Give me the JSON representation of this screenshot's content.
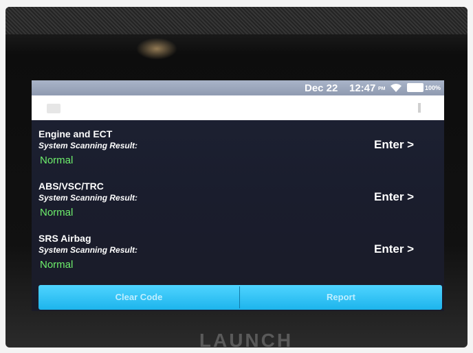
{
  "status_bar": {
    "date": "Dec 22",
    "time": "12:47",
    "ampm": "PM",
    "battery": "100%"
  },
  "systems": [
    {
      "name": "Engine and ECT",
      "scan_label": "System Scanning Result:",
      "result": "Normal",
      "enter_label": "Enter >"
    },
    {
      "name": "ABS/VSC/TRC",
      "scan_label": "System Scanning Result:",
      "result": "Normal",
      "enter_label": "Enter >"
    },
    {
      "name": "SRS Airbag",
      "scan_label": "System Scanning Result:",
      "result": "Normal",
      "enter_label": "Enter >"
    }
  ],
  "bottom_bar": {
    "clear_codes_label": "Clear Code",
    "report_label": "Report"
  },
  "device": {
    "brand": "LAUNCH"
  },
  "colors": {
    "result_ok": "#6ef06c",
    "accent": "#1db4ec",
    "screen_bg": "#1d2233"
  }
}
